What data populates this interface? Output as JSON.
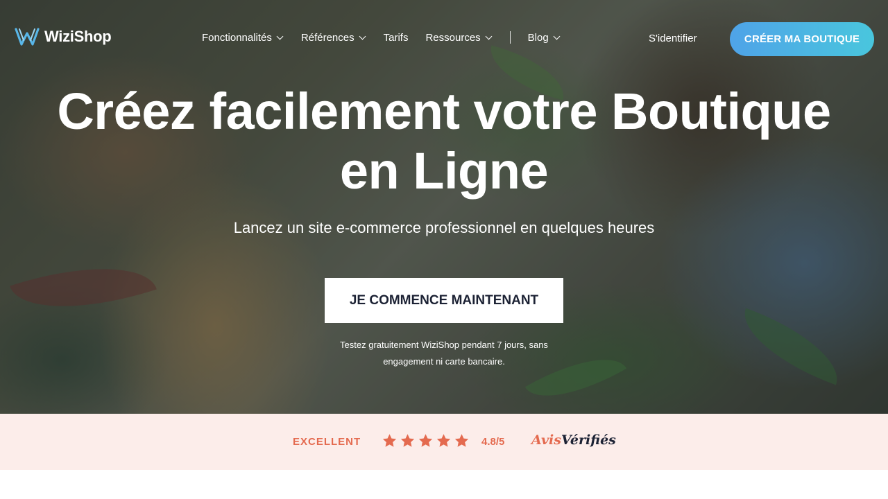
{
  "brand": {
    "name": "WiziShop"
  },
  "nav": {
    "items": [
      {
        "label": "Fonctionnalités",
        "dropdown": true
      },
      {
        "label": "Références",
        "dropdown": true
      },
      {
        "label": "Tarifs",
        "dropdown": false
      },
      {
        "label": "Ressources",
        "dropdown": true
      },
      {
        "label": "Blog",
        "dropdown": true
      }
    ],
    "login": "S'identifier",
    "cta": "CRÉER MA BOUTIQUE"
  },
  "hero": {
    "headline_line1": "Créez facilement votre Boutique",
    "headline_line2": "en Ligne",
    "subtitle": "Lancez un site e-commerce professionnel en quelques heures",
    "cta": "JE COMMENCE MAINTENANT",
    "note_line1": "Testez gratuitement WiziShop pendant 7 jours, sans",
    "note_line2": "engagement ni carte bancaire."
  },
  "rating": {
    "label": "EXCELLENT",
    "stars": 5,
    "score": "4.8/5",
    "provider_part1": "Avis",
    "provider_part2": "Vérifiés"
  },
  "colors": {
    "accent": "#e46a4f",
    "cta_gradient_start": "#4fa3e8",
    "cta_gradient_end": "#49c6dd",
    "rating_bg": "#fcedea",
    "dark_text": "#1c2234"
  }
}
